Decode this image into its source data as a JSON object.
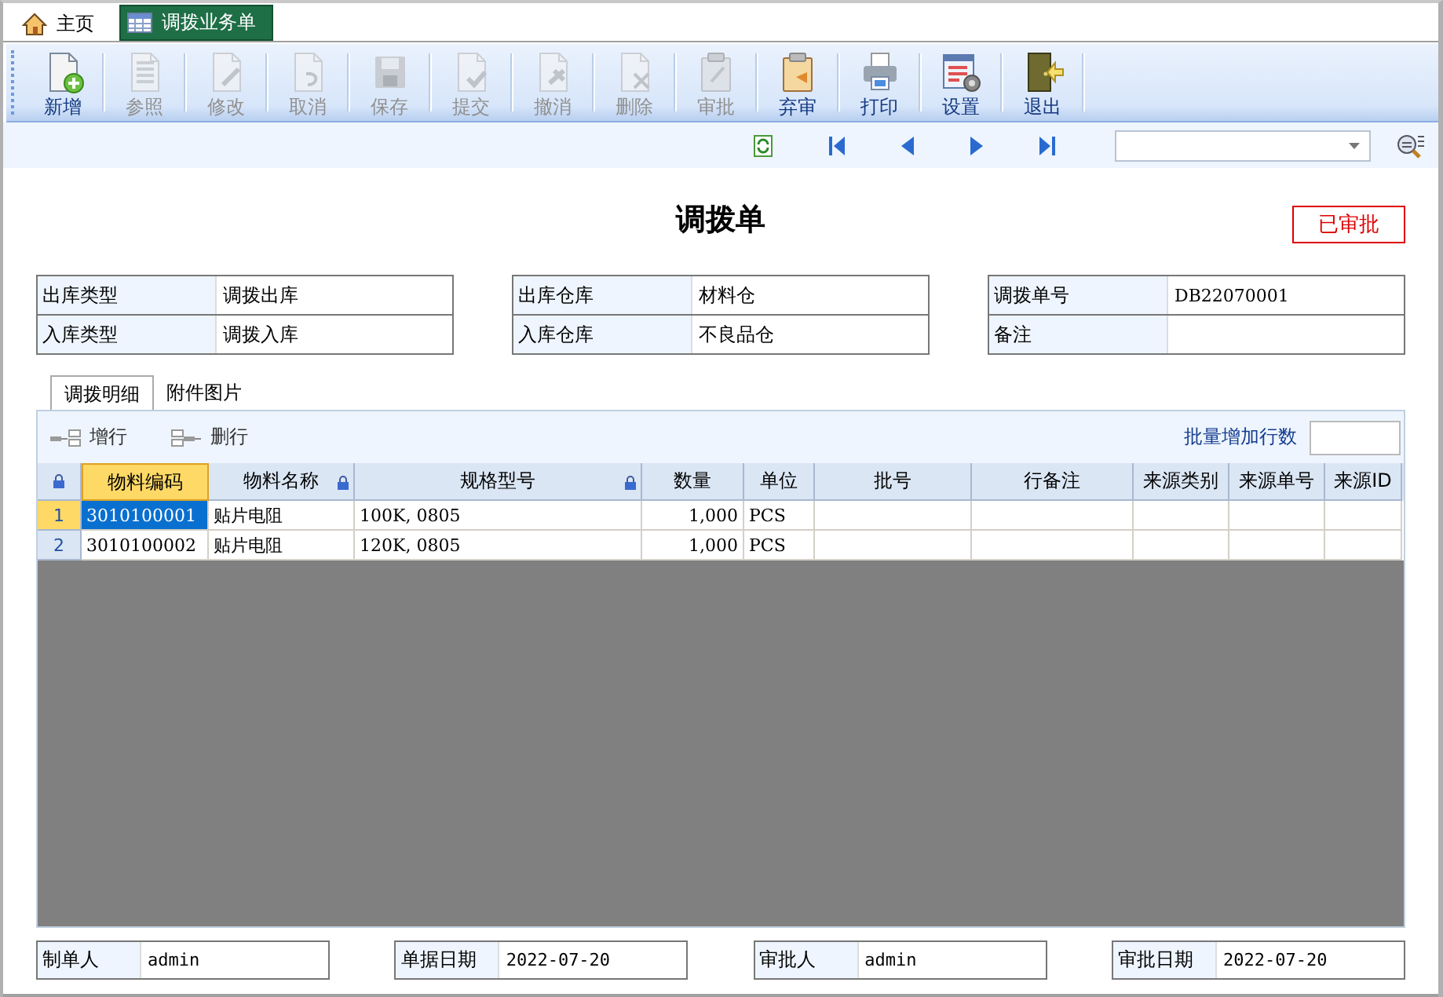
{
  "tabs": [
    {
      "label": "主页",
      "kind": "home",
      "selected": false
    },
    {
      "label": "调拨业务单",
      "kind": "table",
      "selected": true
    }
  ],
  "toolbar": [
    {
      "label": "新增",
      "kind": "new",
      "disabled": false
    },
    {
      "label": "参照",
      "kind": "copy",
      "disabled": true
    },
    {
      "label": "修改",
      "kind": "edit",
      "disabled": true
    },
    {
      "label": "取消",
      "kind": "undo",
      "disabled": true
    },
    {
      "label": "保存",
      "kind": "save",
      "disabled": true
    },
    {
      "label": "提交",
      "kind": "check",
      "disabled": true
    },
    {
      "label": "撤消",
      "kind": "revoke",
      "disabled": true
    },
    {
      "label": "删除",
      "kind": "delete",
      "disabled": true
    },
    {
      "label": "审批",
      "kind": "approve",
      "disabled": true
    },
    {
      "label": "弃审",
      "kind": "unapprove",
      "disabled": false
    },
    {
      "label": "打印",
      "kind": "print",
      "disabled": false
    },
    {
      "label": "设置",
      "kind": "settings",
      "disabled": false
    },
    {
      "label": "退出",
      "kind": "exit",
      "disabled": false
    }
  ],
  "title": "调拨单",
  "status": "已审批",
  "field_groups": [
    [
      {
        "label": "出库类型",
        "value": "调拨出库"
      },
      {
        "label": "入库类型",
        "value": "调拨入库"
      }
    ],
    [
      {
        "label": "出库仓库",
        "value": "材料仓"
      },
      {
        "label": "入库仓库",
        "value": "不良品仓"
      }
    ],
    [
      {
        "label": "调拨单号",
        "value": "DB22070001"
      },
      {
        "label": "备注"
      }
    ]
  ],
  "detail_tabs": [
    {
      "label": "调拨明细",
      "selected": true
    },
    {
      "label": "附件图片",
      "selected": false
    }
  ],
  "grid_actions": [
    {
      "label": "增行",
      "kind": "add"
    },
    {
      "label": "删行",
      "kind": "remove"
    }
  ],
  "batch_label": "批量增加行数",
  "columns": [
    {
      "label": "物料编码",
      "locked": false,
      "selected": true,
      "kind": "text"
    },
    {
      "label": "物料名称",
      "locked": true,
      "selected": false,
      "kind": "text"
    },
    {
      "label": "规格型号",
      "locked": true,
      "selected": false,
      "kind": "text"
    },
    {
      "label": "数量",
      "locked": false,
      "selected": false,
      "kind": "number"
    },
    {
      "label": "单位",
      "locked": false,
      "selected": false,
      "kind": "text"
    },
    {
      "label": "批号",
      "locked": false,
      "selected": false
    },
    {
      "label": "行备注",
      "locked": false,
      "selected": false
    },
    {
      "label": "来源类别",
      "locked": false,
      "selected": false
    },
    {
      "label": "来源单号",
      "locked": false,
      "selected": false
    },
    {
      "label": "来源ID",
      "locked": false,
      "selected": false
    }
  ],
  "rows": [
    {
      "index": "1",
      "selected": true,
      "cells": [
        "3010100001",
        "贴片电阻",
        "100K, 0805",
        "1,000",
        "PCS"
      ]
    },
    {
      "index": "2",
      "selected": false,
      "cells": [
        "3010100002",
        "贴片电阻",
        "120K, 0805",
        "1,000",
        "PCS"
      ]
    }
  ],
  "footer": [
    {
      "label": "制单人",
      "value": "admin"
    },
    {
      "label": "单据日期",
      "value": "2022-07-20"
    },
    {
      "label": "审批人",
      "value": "admin"
    },
    {
      "label": "审批日期",
      "value": "2022-07-20"
    }
  ]
}
